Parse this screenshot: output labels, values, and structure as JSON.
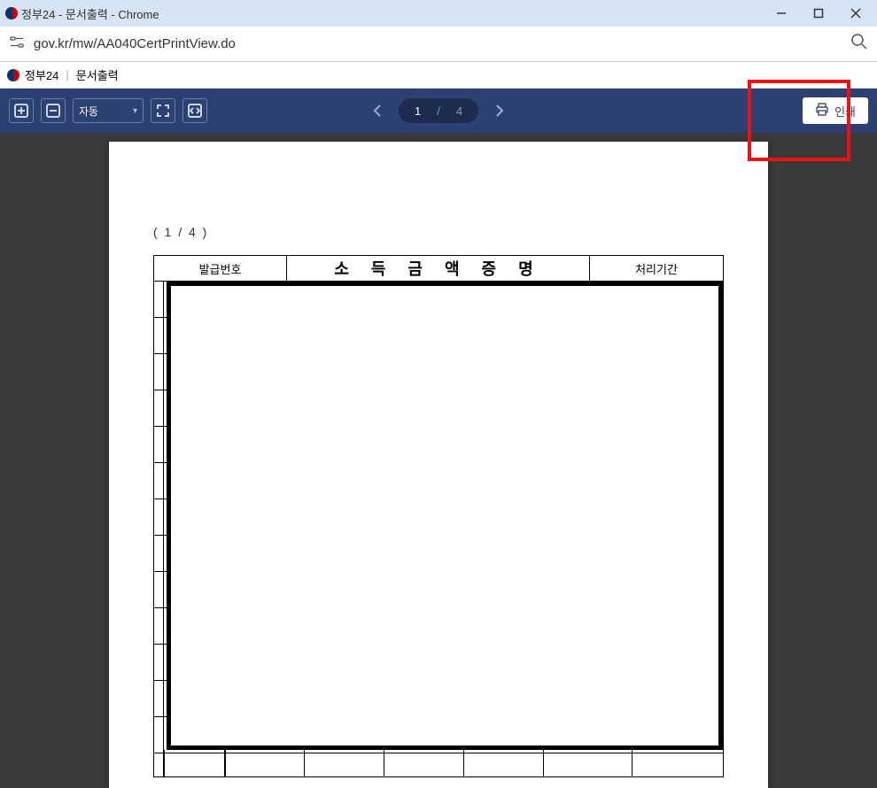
{
  "window": {
    "title": "정부24 - 문서출력 - Chrome"
  },
  "address": {
    "url": "gov.kr/mw/AA040CertPrintView.do"
  },
  "pagehead": {
    "site": "정부24",
    "section": "문서출력"
  },
  "toolbar": {
    "zoom_mode": "자동",
    "page_current": "1",
    "page_sep": "/",
    "page_total": "4",
    "print_label": "인쇄"
  },
  "document": {
    "page_indicator": "( 1  /  4 )",
    "header_left": "발급번호",
    "header_title": "소 득 금 액 증 명",
    "header_right": "처리기간"
  }
}
